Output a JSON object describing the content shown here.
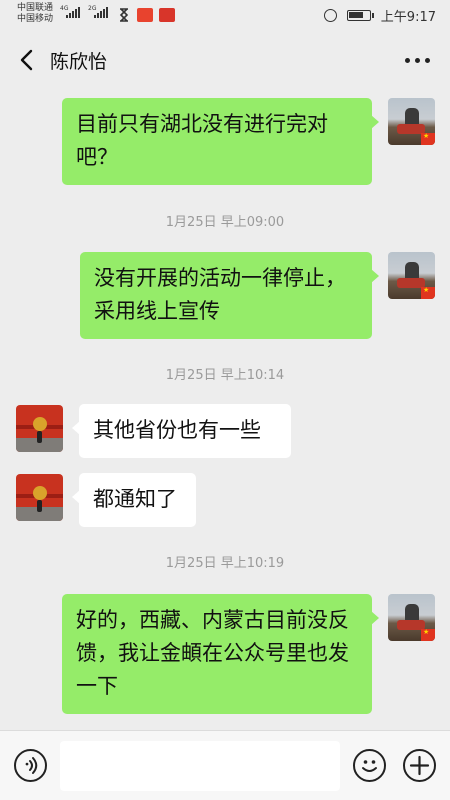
{
  "status_bar": {
    "carrier_1": "中国联通",
    "carrier_2": "中国移动",
    "network_1": "4G",
    "network_2": "2G",
    "time": "上午9:17",
    "icons": [
      "signal-icon",
      "hourglass-icon",
      "app-notification-icon",
      "app-notification-icon",
      "alarm-icon",
      "battery-icon"
    ]
  },
  "header": {
    "title": "陈欣怡",
    "back_icon": "chevron-left-icon",
    "more_icon": "more-dots-icon"
  },
  "messages": [
    {
      "sender": "me",
      "text": "目前只有湖北没有进行完对吧？"
    },
    {
      "timestamp": "1月25日 早上09:00"
    },
    {
      "sender": "me",
      "text": "没有开展的活动一律停止，采用线上宣传"
    },
    {
      "timestamp": "1月25日 早上10:14"
    },
    {
      "sender": "them",
      "text": "其他省份也有一些"
    },
    {
      "sender": "them",
      "text": "都通知了"
    },
    {
      "timestamp": "1月25日 早上10:19"
    },
    {
      "sender": "me",
      "text": "好的，西藏、内蒙古目前没反馈，我让金頔在公众号里也发一下"
    }
  ],
  "input_bar": {
    "placeholder": "",
    "voice_icon": "voice-icon",
    "emoji_icon": "emoji-icon",
    "plus_icon": "plus-icon"
  },
  "colors": {
    "background": "#ededed",
    "outgoing_bubble": "#95ec69",
    "incoming_bubble": "#ffffff",
    "timestamp_text": "#9a9a9a"
  }
}
